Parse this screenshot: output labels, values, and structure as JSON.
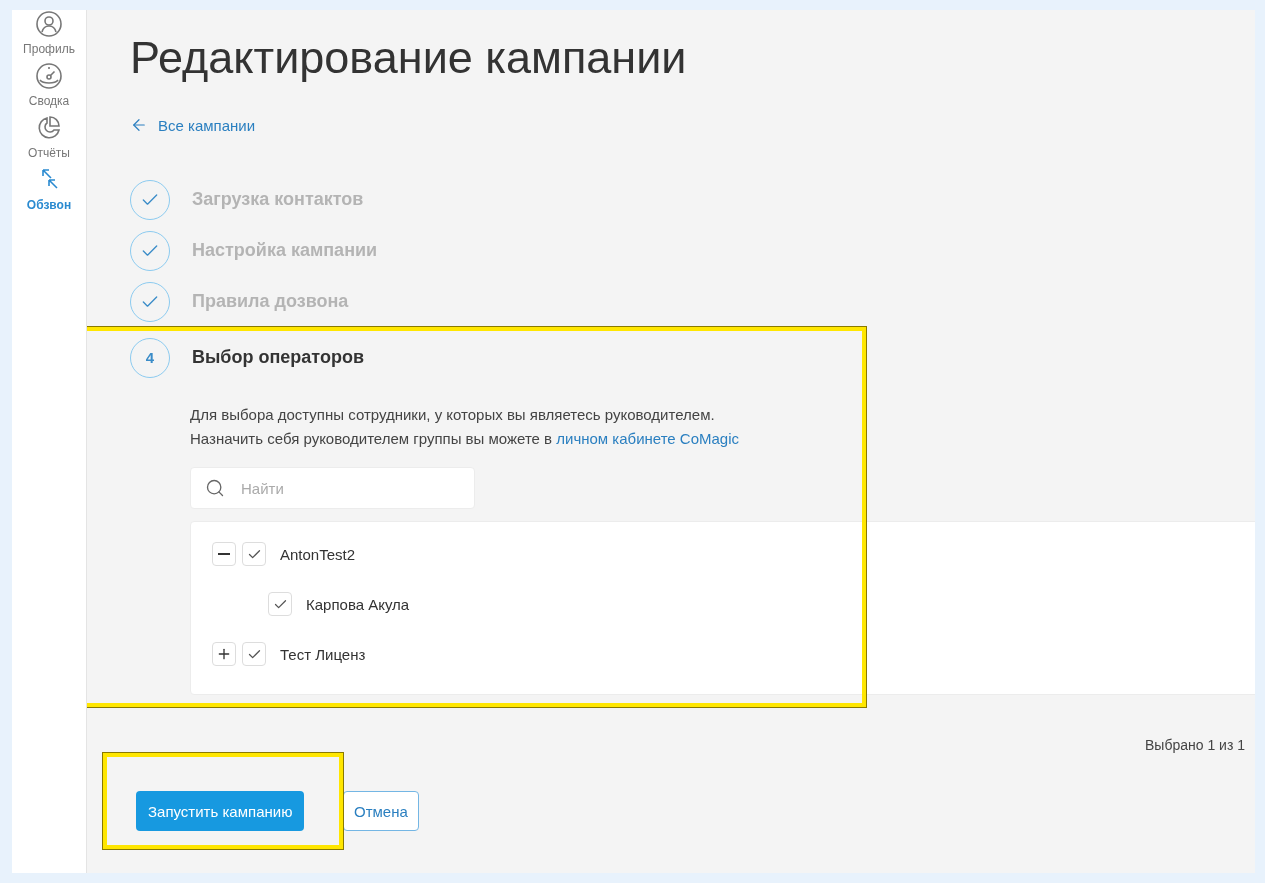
{
  "sidebar": {
    "items": [
      {
        "label": "Профиль",
        "selected": false
      },
      {
        "label": "Сводка",
        "selected": false
      },
      {
        "label": "Отчёты",
        "selected": false
      },
      {
        "label": "Обзвон",
        "selected": true
      }
    ]
  },
  "title": "Редактирование кампании",
  "back_link": "Все кампании",
  "steps": [
    {
      "kind": "done",
      "label": "Загрузка контактов"
    },
    {
      "kind": "done",
      "label": "Настройка кампании"
    },
    {
      "kind": "done",
      "label": "Правила дозвона"
    },
    {
      "kind": "current",
      "number": "4",
      "label": "Выбор операторов",
      "highlighted": true
    }
  ],
  "operators": {
    "description_line_1": "Для выбора доступны сотрудники, у которых вы являетесь руководителем.",
    "description_line_2": "Назначить себя руководителем группы вы можете в",
    "description_link": "личном кабинете CoMagic",
    "search": {
      "placeholder": "Найти"
    },
    "tree": [
      {
        "label": "AntonTest2",
        "checked": true,
        "expanded": true,
        "children": [
          {
            "label": "Карпова Акула",
            "checked": true
          }
        ]
      },
      {
        "label": "Тест Лиценз",
        "checked": true,
        "expanded": false
      }
    ],
    "selected_count": "Выбрано 1 из 1"
  },
  "actions": {
    "highlighted": true,
    "primary": "Запустить кампанию",
    "secondary": "Отмена"
  }
}
